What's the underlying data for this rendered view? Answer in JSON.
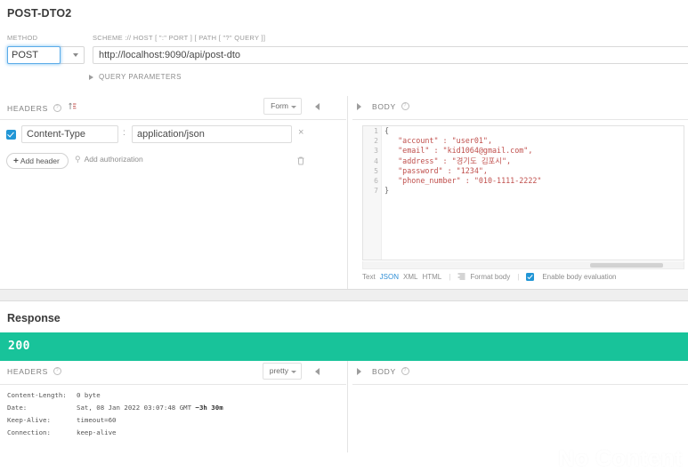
{
  "request": {
    "title": "POST-DTO2",
    "method_label": "METHOD",
    "method_value": "POST",
    "url_label": "SCHEME :// HOST [ \":\" PORT ] [ PATH [ \"?\" QUERY ]]",
    "url_value": "http://localhost:9090/api/post-dto",
    "query_parameters_label": "QUERY PARAMETERS",
    "headers": {
      "title": "HEADERS",
      "view_mode": "Form",
      "rows": [
        {
          "enabled": true,
          "key": "Content-Type",
          "separator": ":",
          "value": "application/json",
          "remove": "×"
        }
      ],
      "add_header_label": "Add header",
      "add_authorization_label": "Add authorization"
    },
    "body": {
      "title": "BODY",
      "line_numbers": [
        "1",
        "2",
        "3",
        "4",
        "5",
        "6",
        "7"
      ],
      "lines": [
        "{",
        "   \"account\" : \"user01\",",
        "   \"email\" : \"kid1064@gmail.com\",",
        "   \"address\" : \"경기도 김포시\",",
        "   \"password\" : \"1234\",",
        "   \"phone_number\" : \"010-1111-2222\"",
        "}"
      ],
      "toolbar": {
        "formats": [
          "Text",
          "JSON",
          "XML",
          "HTML"
        ],
        "active_format": "JSON",
        "format_body_label": "Format body",
        "enable_body_evaluation_label": "Enable body evaluation",
        "enable_body_evaluation_checked": true
      }
    }
  },
  "response": {
    "title": "Response",
    "status_code": "200",
    "status_color": "#18c39a",
    "headers": {
      "title": "HEADERS",
      "view_mode": "pretty",
      "rows": [
        {
          "key": "Content-Length:",
          "value": "0 byte",
          "bold_suffix": ""
        },
        {
          "key": "Date:",
          "value": "Sat, 08 Jan 2022 03:07:48 GMT ",
          "bold_suffix": "−3h 30m"
        },
        {
          "key": "Keep-Alive:",
          "value": "timeout=60",
          "bold_suffix": ""
        },
        {
          "key": "Connection:",
          "value": "keep-alive",
          "bold_suffix": ""
        }
      ]
    },
    "body": {
      "title": "BODY",
      "placeholder": "No Content"
    }
  }
}
